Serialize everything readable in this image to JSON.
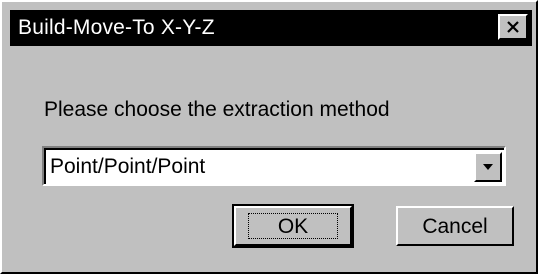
{
  "window": {
    "title": "Build-Move-To X-Y-Z",
    "close_icon": "close-icon"
  },
  "body": {
    "prompt": "Please choose the extraction method"
  },
  "method_select": {
    "value": "Point/Point/Point",
    "arrow_icon": "dropdown-arrow-icon"
  },
  "buttons": {
    "ok_label": "OK",
    "cancel_label": "Cancel"
  },
  "colors": {
    "face": "#c0c0c0",
    "titlebar": "#000000",
    "title_text": "#ffffff"
  }
}
